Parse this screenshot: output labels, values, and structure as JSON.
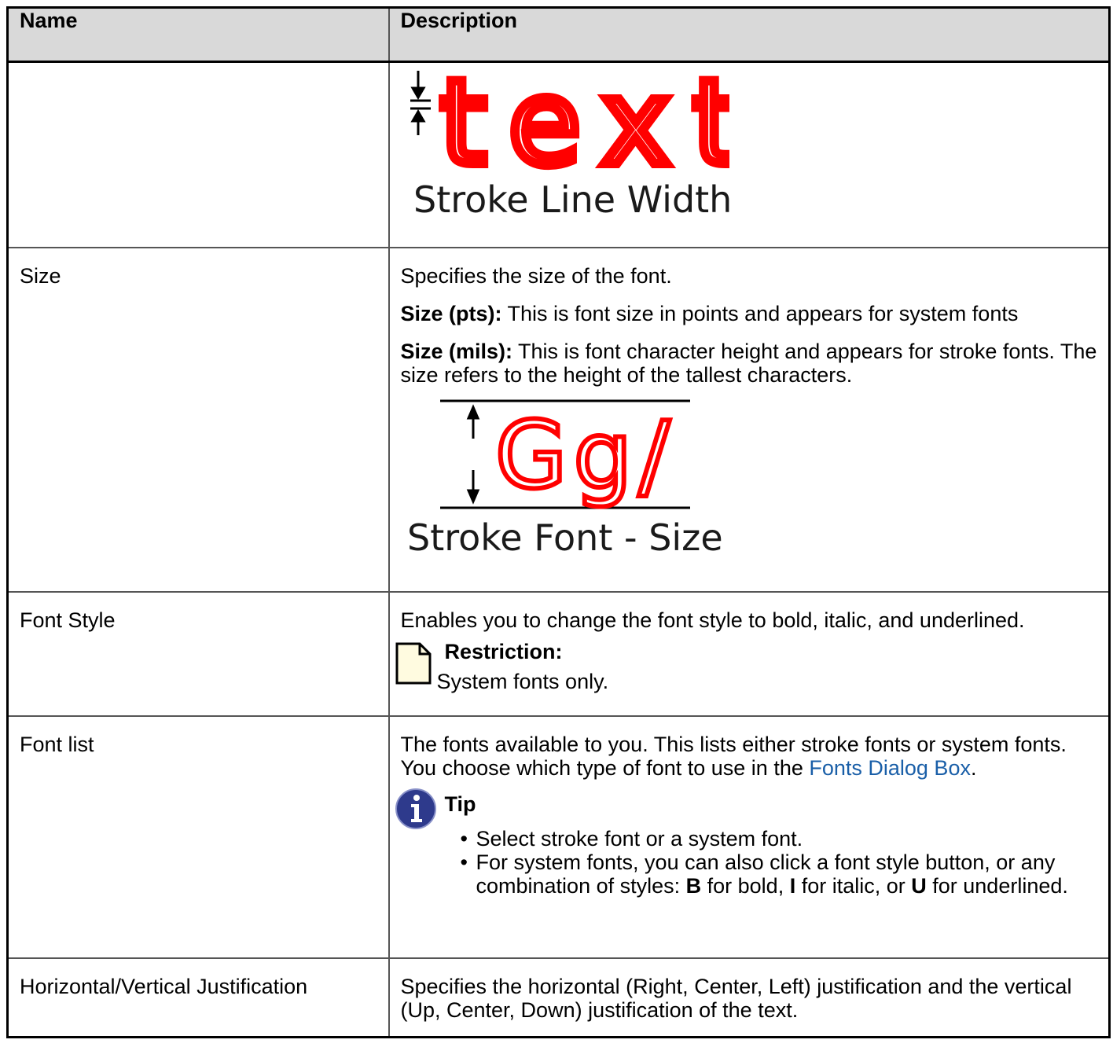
{
  "table": {
    "headers": {
      "name": "Name",
      "description": "Description"
    },
    "stroke_width_figure": {
      "sample": "text",
      "caption": "Stroke Line Width"
    },
    "size": {
      "name": "Size",
      "intro": "Specifies the size of the font.",
      "pts_label": "Size (pts):",
      "pts_text": " This is font size in points and appears for system fonts",
      "mils_label": "Size (mils):",
      "mils_text": " This is font character height and appears for stroke fonts. The size refers to the height of the tallest characters.",
      "figure": {
        "sample": "Gg/",
        "caption": "Stroke Font - Size"
      }
    },
    "font_style": {
      "name": "Font Style",
      "text": "Enables you to change the font style to bold, italic, and underlined.",
      "note_title": "Restriction:",
      "note_body": "System fonts only."
    },
    "font_list": {
      "name": "Font list",
      "text_before": "The fonts available to you. This lists either stroke fonts or system fonts. You choose which type of font to use in the ",
      "link": "Fonts Dialog Box",
      "text_after": ".",
      "tip_title": "Tip",
      "tip_item1": "Select stroke font or a system font.",
      "tip_item2_a": "For system fonts, you can also click a font style button, or any combination of styles: ",
      "tip_b": "B",
      "tip_item2_b": " for bold, ",
      "tip_i": "I",
      "tip_item2_c": " for italic, or ",
      "tip_u": "U",
      "tip_item2_d": " for underlined."
    },
    "justification": {
      "name": "Horizontal/Vertical Justification",
      "text": "Specifies the horizontal (Right, Center, Left) justification and the vertical (Up, Center, Down) justification of the text."
    }
  },
  "colors": {
    "header_bg": "#d9d9d9",
    "sample_red": "#ff0000",
    "link": "#1a5fa8",
    "tip_icon": "#2e3a8c",
    "note_icon": "#fffbe0"
  }
}
